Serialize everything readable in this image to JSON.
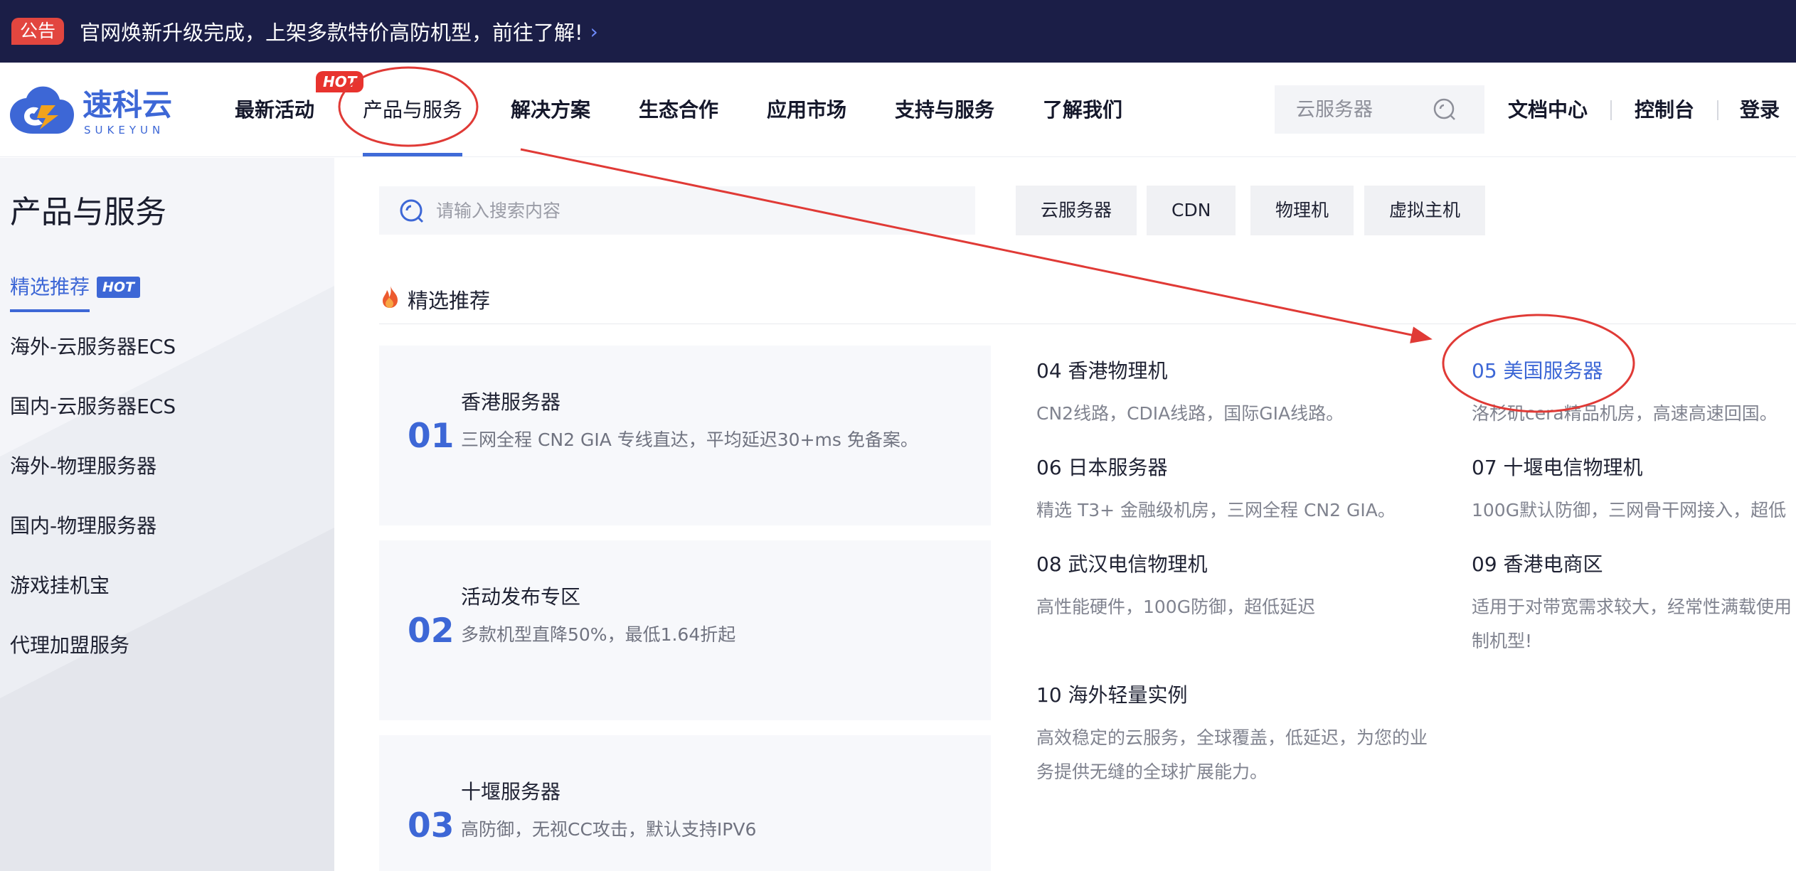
{
  "announcement": {
    "badge": "公告",
    "text": "官网焕新升级完成，上架多款特价高防机型，前往了解!",
    "chevron": "›"
  },
  "logo": {
    "name": "速科云",
    "sub": "SUKEYUN"
  },
  "nav": {
    "items": [
      "最新活动",
      "产品与服务",
      "解决方案",
      "生态合作",
      "应用市场",
      "支持与服务",
      "了解我们"
    ],
    "hot_badge": "HOT",
    "search_placeholder": "云服务器",
    "docs": "文档中心",
    "console": "控制台",
    "login": "登录"
  },
  "sidebar": {
    "title": "产品与服务",
    "hot_badge": "HOT",
    "items": [
      "精选推荐",
      "海外-云服务器ECS",
      "国内-云服务器ECS",
      "海外-物理服务器",
      "国内-物理服务器",
      "游戏挂机宝",
      "代理加盟服务"
    ]
  },
  "main": {
    "search_placeholder": "请输入搜索内容",
    "chips": [
      "云服务器",
      "CDN",
      "物理机",
      "虚拟主机"
    ],
    "section_title": "精选推荐",
    "featured": [
      {
        "num": "01",
        "title": "香港服务器",
        "desc": "三网全程 CN2 GIA 专线直达，平均延迟30+ms 免备案。"
      },
      {
        "num": "02",
        "title": "活动发布专区",
        "desc": "多款机型直降50%，最低1.64折起"
      },
      {
        "num": "03",
        "title": "十堰服务器",
        "desc": "高防御，无视CC攻击，默认支持IPV6"
      }
    ],
    "products": [
      {
        "title": "04 香港物理机",
        "desc": [
          "CN2线路，CDIA线路，国际GIA线路。"
        ]
      },
      {
        "title": "05 美国服务器",
        "desc": [
          "洛杉矶cera精品机房，高速高速回国。"
        ]
      },
      {
        "title": "06 日本服务器",
        "desc": [
          "精选 T3+ 金融级机房，三网全程 CN2 GIA。"
        ]
      },
      {
        "title": "07 十堰电信物理机",
        "desc": [
          "100G默认防御，三网骨干网接入，超低"
        ]
      },
      {
        "title": "08 武汉电信物理机",
        "desc": [
          "高性能硬件，100G防御，超低延迟"
        ]
      },
      {
        "title": "09 香港电商区",
        "desc": [
          "适用于对带宽需求较大，经常性满载使用",
          "制机型!"
        ]
      },
      {
        "title": "10 海外轻量实例",
        "desc": [
          "高效稳定的云服务，全球覆盖，低延迟，为您的业",
          "务提供无缝的全球扩展能力。"
        ]
      }
    ]
  },
  "colors": {
    "accent": "#3d67d6",
    "topbar": "#1b1e47",
    "annotation": "#e03a36"
  }
}
